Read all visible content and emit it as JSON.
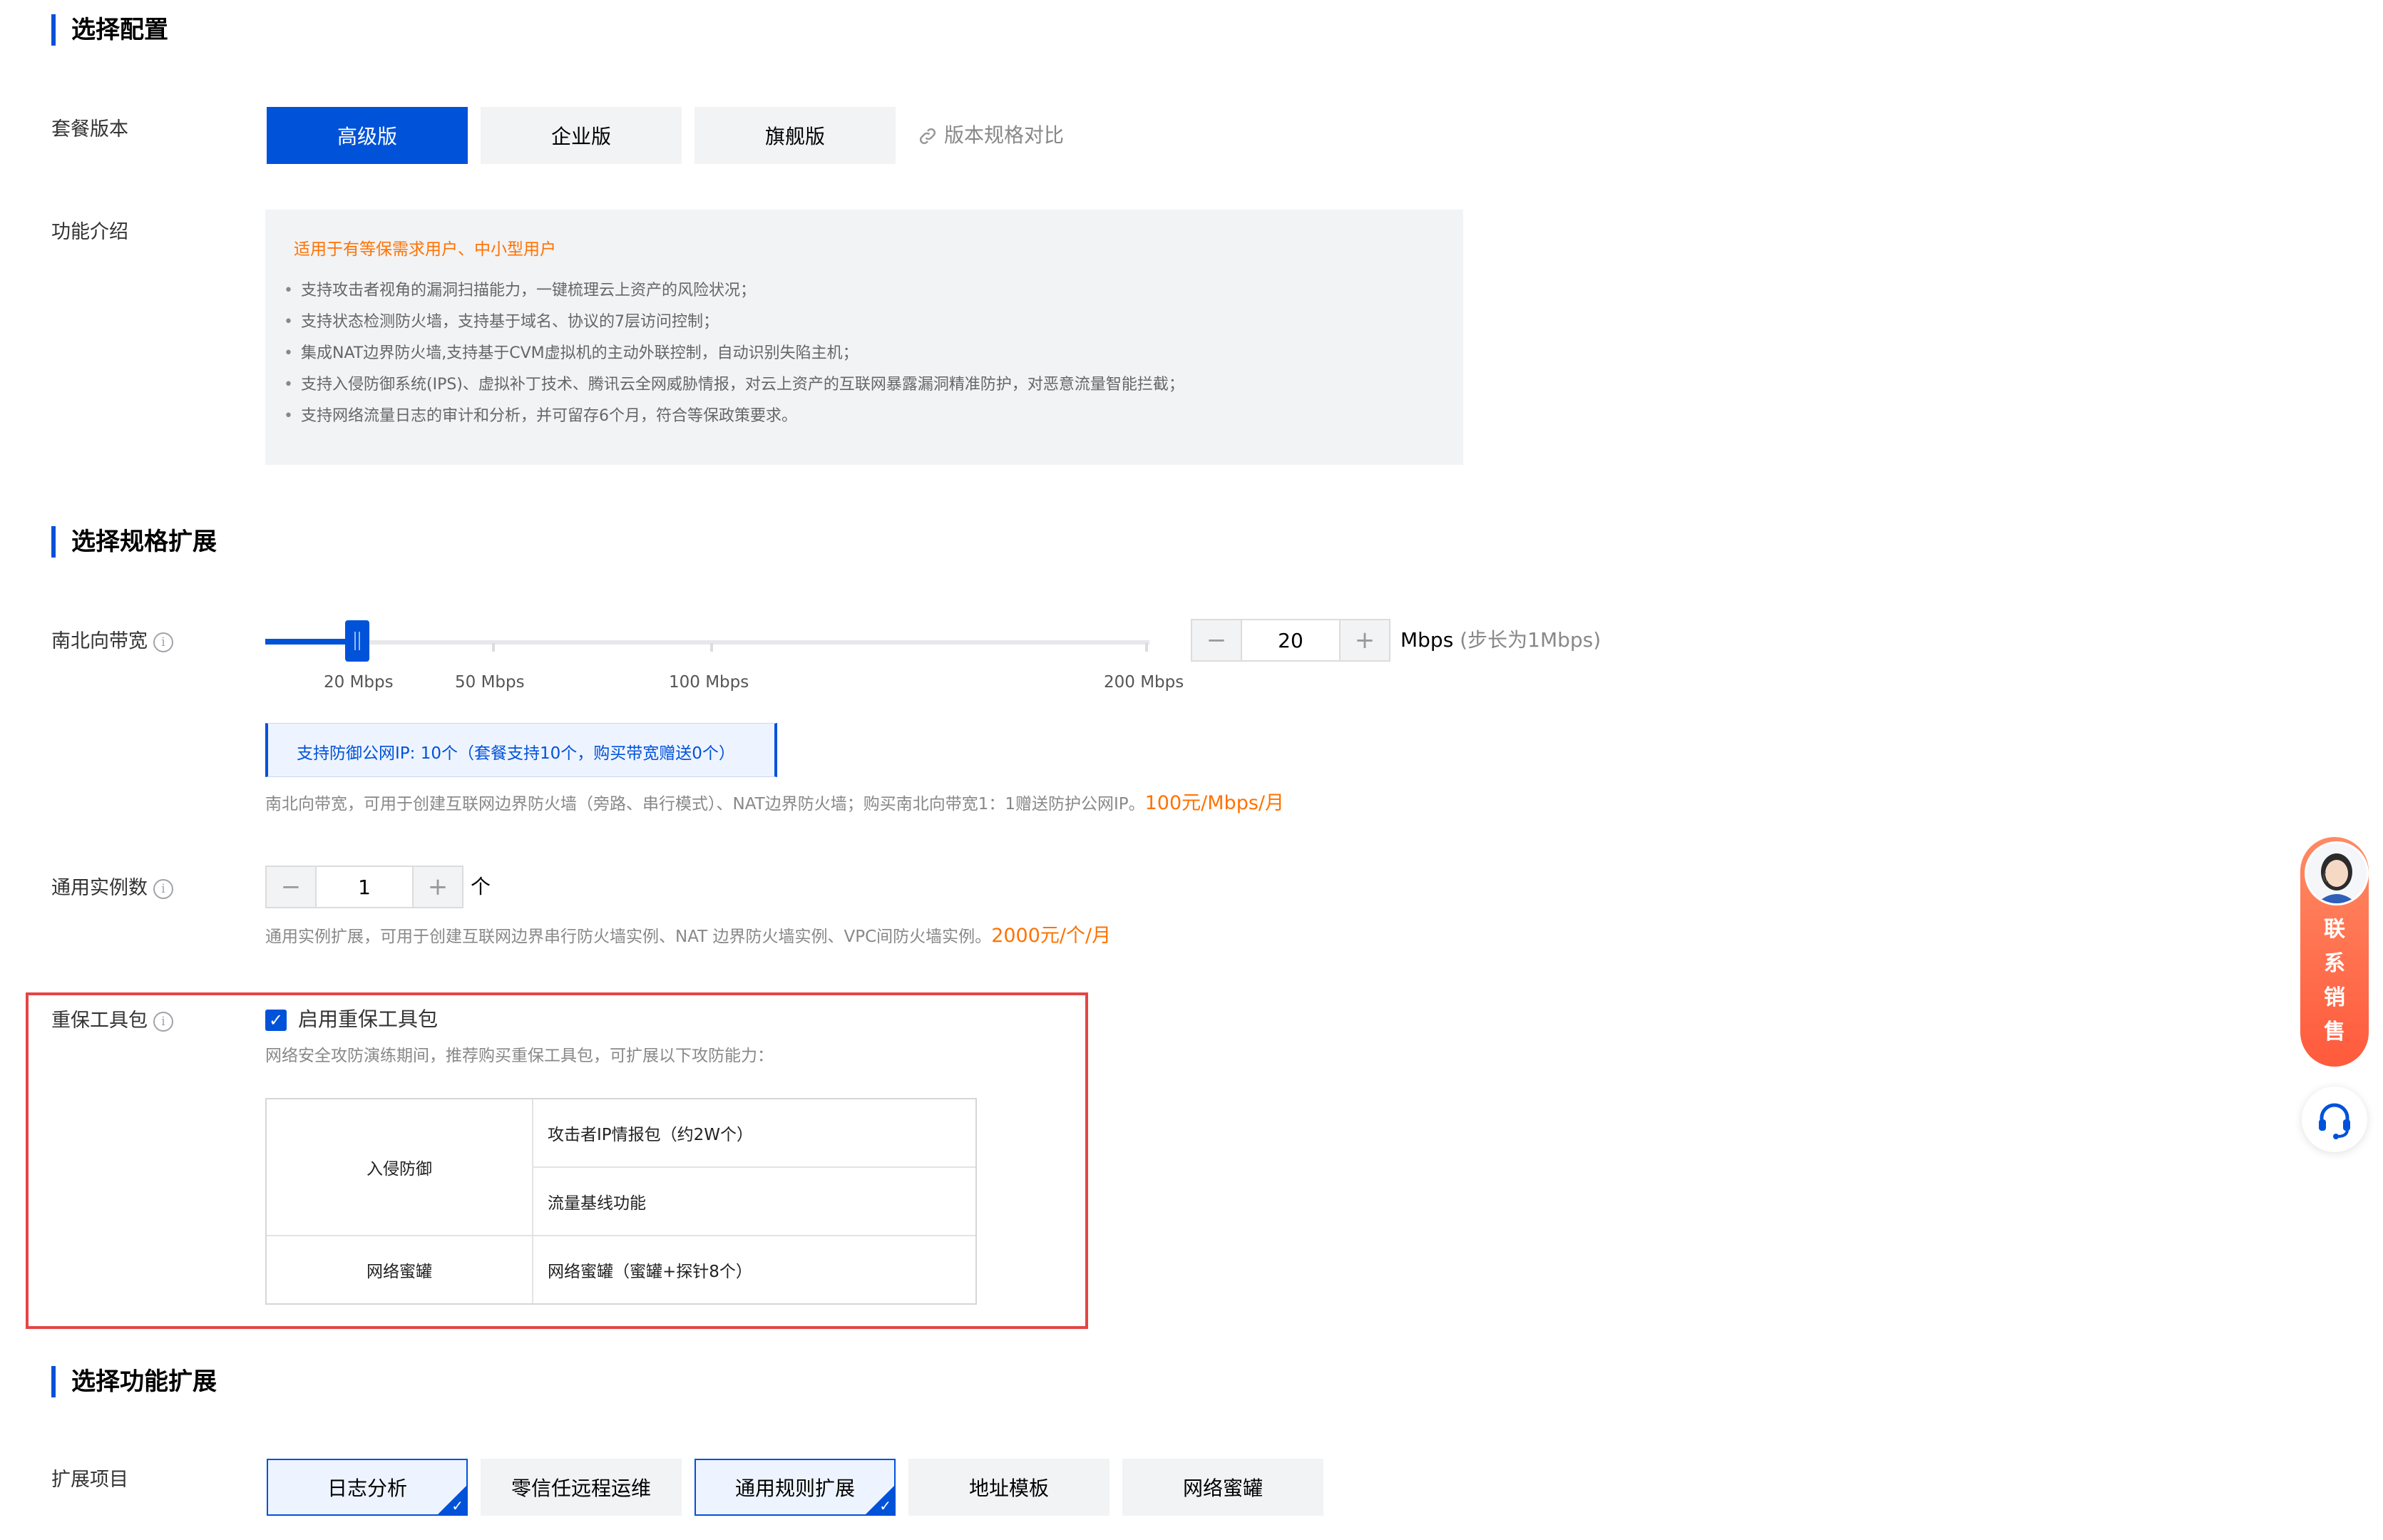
{
  "sections": {
    "config_title": "选择配置",
    "spec_title": "选择规格扩展",
    "feature_ext_title": "选择功能扩展"
  },
  "package": {
    "label": "套餐版本",
    "options": [
      "高级版",
      "企业版",
      "旗舰版"
    ],
    "selected": "高级版",
    "compare_link": "版本规格对比"
  },
  "features": {
    "label": "功能介绍",
    "headline": "适用于有等保需求用户、中小型用户",
    "items": [
      "支持攻击者视角的漏洞扫描能力，一键梳理云上资产的风险状况；",
      "支持状态检测防火墙，支持基于域名、协议的7层访问控制；",
      "集成NAT边界防火墙,支持基于CVM虚拟机的主动外联控制，自动识别失陷主机；",
      "支持入侵防御系统(IPS)、虚拟补丁技术、腾讯云全网威胁情报，对云上资产的互联网暴露漏洞精准防护，对恶意流量智能拦截；",
      "支持网络流量日志的审计和分析，并可留存6个月，符合等保政策要求。"
    ]
  },
  "bandwidth": {
    "label": "南北向带宽",
    "ticks": [
      "20 Mbps",
      "50 Mbps",
      "100 Mbps",
      "200 Mbps"
    ],
    "slider_value": 20,
    "slider_max": 200,
    "minus": "−",
    "value": "20",
    "plus": "+",
    "unit": "Mbps",
    "step_hint": "(步长为1Mbps)",
    "ip_info": "支持防御公网IP: 10个（套餐支持10个，购买带宽赠送0个）",
    "note": "南北向带宽，可用于创建互联网边界防火墙（旁路、串行模式）、NAT边界防火墙；购买南北向带宽1：1赠送防护公网IP。",
    "price": "100元/Mbps/月"
  },
  "instances": {
    "label": "通用实例数",
    "minus": "−",
    "value": "1",
    "plus": "+",
    "unit": "个",
    "note": "通用实例扩展，可用于创建互联网边界串行防火墙实例、NAT 边界防火墙实例、VPC间防火墙实例。",
    "price": "2000元/个/月"
  },
  "toolkit": {
    "label": "重保工具包",
    "checkbox_label": "启用重保工具包",
    "checked": true,
    "description": "网络安全攻防演练期间，推荐购买重保工具包，可扩展以下攻防能力：",
    "rows": [
      {
        "category": "入侵防御",
        "items": [
          "攻击者IP情报包（约2W个）",
          "流量基线功能"
        ]
      },
      {
        "category": "网络蜜罐",
        "items": [
          "网络蜜罐（蜜罐+探针8个）"
        ]
      }
    ]
  },
  "extensions": {
    "label": "扩展项目",
    "options": [
      "日志分析",
      "零信任远程运维",
      "通用规则扩展",
      "地址模板",
      "网络蜜罐"
    ],
    "selected": [
      "日志分析",
      "通用规则扩展"
    ]
  },
  "float": {
    "sales": "联系销售"
  },
  "colors": {
    "primary": "#0052d9",
    "accent_orange": "#ff7200",
    "highlight_frame": "#e54545",
    "panel_bg": "#f2f3f5"
  }
}
